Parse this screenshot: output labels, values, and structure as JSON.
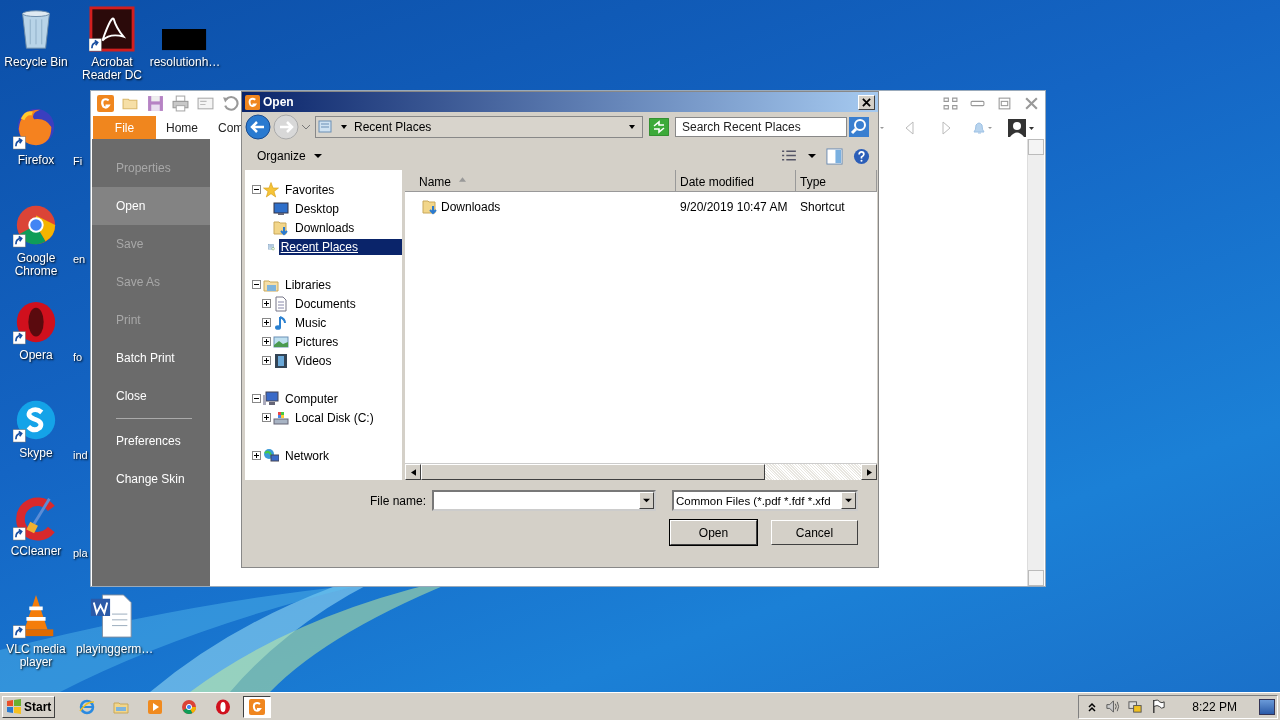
{
  "desktop": {
    "icons": [
      {
        "label": "Recycle Bin",
        "kind": "bin",
        "shortcut": false
      },
      {
        "label": "Acrobat Reader DC",
        "kind": "acrobat",
        "shortcut": true
      },
      {
        "label": "resolutionh…",
        "kind": "blank",
        "shortcut": false
      },
      {
        "label": "Firefox",
        "kind": "firefox",
        "shortcut": true
      },
      {
        "label": "Google Chrome",
        "kind": "chrome",
        "shortcut": true
      },
      {
        "label": "Opera",
        "kind": "opera",
        "shortcut": true
      },
      {
        "label": "Skype",
        "kind": "skype",
        "shortcut": true
      },
      {
        "label": "CCleaner",
        "kind": "ccleaner",
        "shortcut": true
      },
      {
        "label": "VLC media player",
        "kind": "vlc",
        "shortcut": true
      },
      {
        "label": "playinggerm…",
        "kind": "word",
        "shortcut": false
      }
    ],
    "covered_labels": [
      "Fi",
      "en",
      "fo",
      "ind",
      "pla"
    ]
  },
  "app": {
    "tabs": [
      {
        "label": "File",
        "selected": true
      },
      {
        "label": "Home",
        "selected": false
      },
      {
        "label": "Com",
        "selected": false
      }
    ],
    "menu": [
      {
        "items": [
          {
            "label": "Properties",
            "disabled": true,
            "selected": false
          },
          {
            "label": "Open",
            "disabled": false,
            "selected": true
          },
          {
            "label": "Save",
            "disabled": true,
            "selected": false
          },
          {
            "label": "Save As",
            "disabled": true,
            "selected": false
          },
          {
            "label": "Print",
            "disabled": true,
            "selected": false
          },
          {
            "label": "Batch Print",
            "disabled": false,
            "selected": false
          },
          {
            "label": "Close",
            "disabled": false,
            "selected": false
          }
        ]
      },
      {
        "items": [
          {
            "label": "Preferences",
            "disabled": false,
            "selected": false
          },
          {
            "label": "Change Skin",
            "disabled": false,
            "selected": false
          }
        ]
      }
    ]
  },
  "dialog": {
    "title": "Open",
    "address": "Recent Places",
    "search": {
      "placeholder": "Search Recent Places"
    },
    "organize": "Organize",
    "tree": [
      {
        "label": "Favorites",
        "kind": "star",
        "expanded": true,
        "selected": false,
        "children": [
          {
            "label": "Desktop",
            "kind": "desktop",
            "selected": false
          },
          {
            "label": "Downloads",
            "kind": "downloads",
            "selected": false
          },
          {
            "label": "Recent Places",
            "kind": "recent",
            "selected": true
          }
        ]
      },
      {
        "label": "Libraries",
        "kind": "libraries",
        "expanded": true,
        "selected": false,
        "children": [
          {
            "label": "Documents",
            "kind": "documents",
            "expanded": false,
            "selected": false
          },
          {
            "label": "Music",
            "kind": "music",
            "expanded": false,
            "selected": false
          },
          {
            "label": "Pictures",
            "kind": "pictures",
            "expanded": false,
            "selected": false
          },
          {
            "label": "Videos",
            "kind": "videos",
            "expanded": false,
            "selected": false
          }
        ]
      },
      {
        "label": "Computer",
        "kind": "computer",
        "expanded": true,
        "selected": false,
        "children": [
          {
            "label": "Local Disk (C:)",
            "kind": "disk",
            "expanded": false,
            "selected": false
          }
        ]
      },
      {
        "label": "Network",
        "kind": "network",
        "expanded": false,
        "selected": false
      }
    ],
    "columns": [
      "Name",
      "Date modified",
      "Type"
    ],
    "rows": [
      {
        "name": "Downloads",
        "date": "9/20/2019 10:47 AM",
        "type": "Shortcut"
      }
    ],
    "file_name_label": "File name:",
    "file_type": "Common Files (*.pdf *.fdf *.xfd",
    "buttons": [
      "Open",
      "Cancel"
    ]
  },
  "taskbar": {
    "start": "Start",
    "apps": [
      {
        "kind": "ie",
        "selected": false
      },
      {
        "kind": "explorer",
        "selected": false
      },
      {
        "kind": "media",
        "selected": false
      },
      {
        "kind": "chrome",
        "selected": false
      },
      {
        "kind": "opera",
        "selected": false
      },
      {
        "kind": "foxit",
        "selected": true
      }
    ],
    "clock": "8:22 PM"
  }
}
